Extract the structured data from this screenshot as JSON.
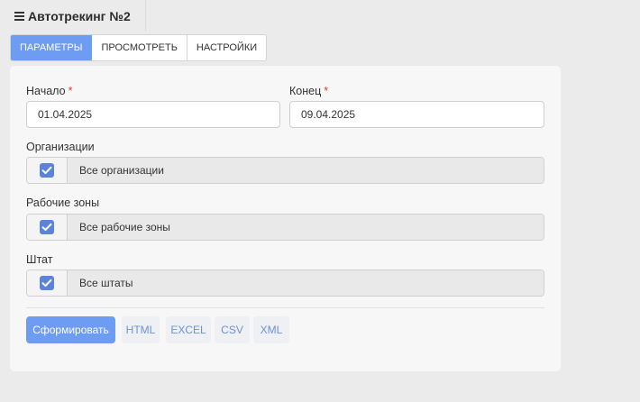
{
  "header": {
    "icon": "menu-icon",
    "title": "Автотрекинг №2"
  },
  "tabs": [
    {
      "label": "ПАРАМЕТРЫ",
      "active": true
    },
    {
      "label": "ПРОСМОТРЕТЬ",
      "active": false
    },
    {
      "label": "НАСТРОЙКИ",
      "active": false
    }
  ],
  "form": {
    "start": {
      "label": "Начало",
      "required_mark": "*",
      "value": "01.04.2025"
    },
    "end": {
      "label": "Конец",
      "required_mark": "*",
      "value": "09.04.2025"
    },
    "organizations": {
      "label": "Организации",
      "checked": true,
      "text": "Все организации"
    },
    "work_zones": {
      "label": "Рабочие зоны",
      "checked": true,
      "text": "Все рабочие зоны"
    },
    "staff": {
      "label": "Штат",
      "checked": true,
      "text": "Все штаты"
    }
  },
  "actions": {
    "generate": "Сформировать",
    "html": "HTML",
    "excel": "EXCEL",
    "csv": "CSV",
    "xml": "XML"
  },
  "colors": {
    "accent": "#6e9cf2",
    "checkbox": "#5b84d8",
    "required": "#e53935",
    "export_text": "#6b93d8"
  }
}
